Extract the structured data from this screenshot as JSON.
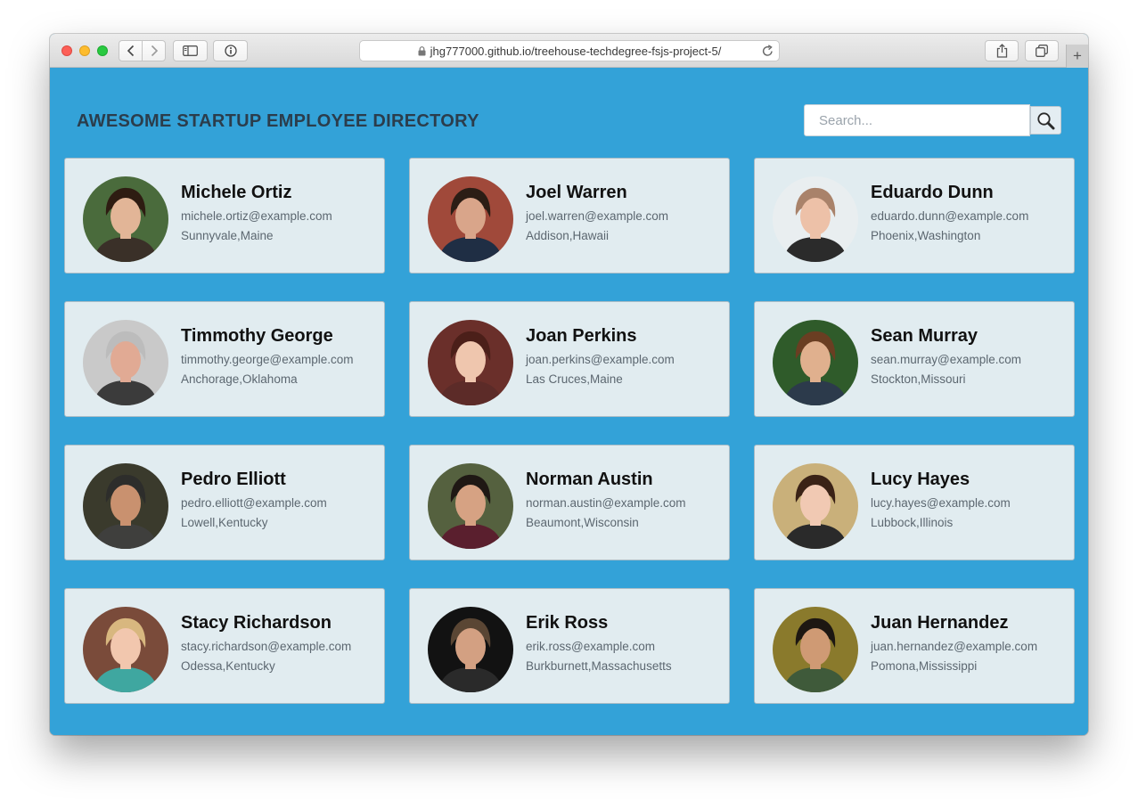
{
  "browser": {
    "url": "jhg777000.github.io/treehouse-techdegree-fsjs-project-5/",
    "new_tab_label": "+"
  },
  "header": {
    "title": "AWESOME STARTUP EMPLOYEE DIRECTORY",
    "search_placeholder": "Search..."
  },
  "employees": [
    {
      "name": "Michele Ortiz",
      "email": "michele.ortiz@example.com",
      "location": "Sunnyvale,Maine",
      "avatar": {
        "bg": "#4a6b3c",
        "hair": "#2e1c12",
        "skin": "#e2b597",
        "shirt": "#3a3028"
      }
    },
    {
      "name": "Joel Warren",
      "email": "joel.warren@example.com",
      "location": "Addison,Hawaii",
      "avatar": {
        "bg": "#a0493a",
        "hair": "#2b1d15",
        "skin": "#d9a58a",
        "shirt": "#1f2e44"
      }
    },
    {
      "name": "Eduardo Dunn",
      "email": "eduardo.dunn@example.com",
      "location": "Phoenix,Washington",
      "avatar": {
        "bg": "#e9eef0",
        "hair": "#a9826a",
        "skin": "#edc1a8",
        "shirt": "#2b2b2b"
      }
    },
    {
      "name": "Timmothy George",
      "email": "timmothy.george@example.com",
      "location": "Anchorage,Oklahoma",
      "avatar": {
        "bg": "#c9c9c9",
        "hair": "#bcbcbc",
        "skin": "#e1aa94",
        "shirt": "#3b3b3b"
      }
    },
    {
      "name": "Joan Perkins",
      "email": "joan.perkins@example.com",
      "location": "Las Cruces,Maine",
      "avatar": {
        "bg": "#6a2f2a",
        "hair": "#4b1f19",
        "skin": "#efc6ae",
        "shirt": "#5c2b28"
      }
    },
    {
      "name": "Sean Murray",
      "email": "sean.murray@example.com",
      "location": "Stockton,Missouri",
      "avatar": {
        "bg": "#2f5b2a",
        "hair": "#6a3e22",
        "skin": "#e0b08e",
        "shirt": "#2c3a4b"
      }
    },
    {
      "name": "Pedro Elliott",
      "email": "pedro.elliott@example.com",
      "location": "Lowell,Kentucky",
      "avatar": {
        "bg": "#3a3a2c",
        "hair": "#2d2d2b",
        "skin": "#c9916f",
        "shirt": "#3f3f3d"
      }
    },
    {
      "name": "Norman Austin",
      "email": "norman.austin@example.com",
      "location": "Beaumont,Wisconsin",
      "avatar": {
        "bg": "#55613f",
        "hair": "#1f1814",
        "skin": "#d6a283",
        "shirt": "#5a1f2e"
      }
    },
    {
      "name": "Lucy Hayes",
      "email": "lucy.hayes@example.com",
      "location": "Lubbock,Illinois",
      "avatar": {
        "bg": "#c9b07a",
        "hair": "#3a2216",
        "skin": "#f1c9b3",
        "shirt": "#2a2a2a"
      }
    },
    {
      "name": "Stacy Richardson",
      "email": "stacy.richardson@example.com",
      "location": "Odessa,Kentucky",
      "avatar": {
        "bg": "#7a4b3a",
        "hair": "#d8b77f",
        "skin": "#f2c7ae",
        "shirt": "#3fa7a0"
      }
    },
    {
      "name": "Erik Ross",
      "email": "erik.ross@example.com",
      "location": "Burkburnett,Massachusetts",
      "avatar": {
        "bg": "#121212",
        "hair": "#5a4634",
        "skin": "#d3a082",
        "shirt": "#2a2a2a"
      }
    },
    {
      "name": "Juan Hernandez",
      "email": "juan.hernandez@example.com",
      "location": "Pomona,Mississippi",
      "avatar": {
        "bg": "#8a7a2c",
        "hair": "#1d1712",
        "skin": "#cf9a74",
        "shirt": "#3f5a3a"
      }
    }
  ]
}
